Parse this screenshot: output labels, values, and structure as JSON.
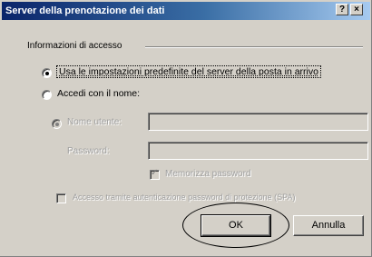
{
  "window": {
    "title": "Server della prenotazione dei dati",
    "help_glyph": "?",
    "close_glyph": "×"
  },
  "group": {
    "label": "Informazioni di accesso"
  },
  "options": {
    "use_default": "Usa le impostazioni predefinite del server della posta in arrivo",
    "log_on_using": "Accedi con il nome:"
  },
  "fields": {
    "username_label": "Nome utente:",
    "password_label": "Password:",
    "remember_password": "Memorizza password"
  },
  "spa": {
    "label": "Accesso tramite autenticazione password di protezione (SPA)"
  },
  "buttons": {
    "ok": "OK",
    "cancel": "Annulla"
  }
}
